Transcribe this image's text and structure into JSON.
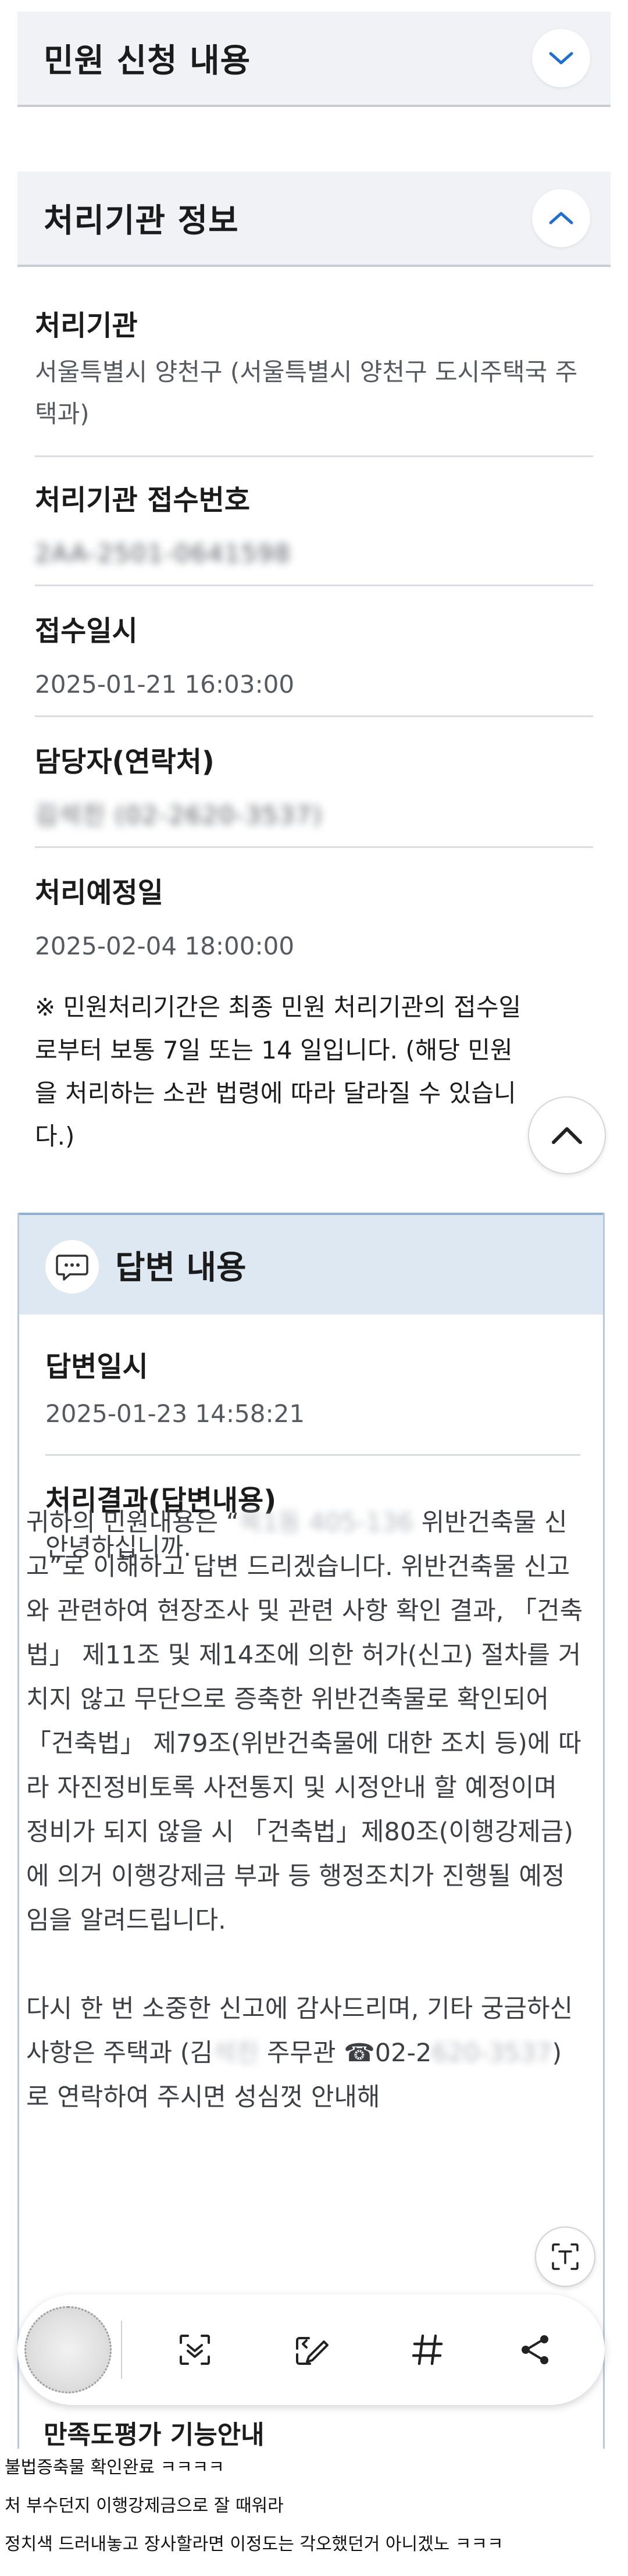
{
  "sections": {
    "complaint_title": "민원 신청 내용",
    "agency_title": "처리기관 정보"
  },
  "agency": {
    "agency_label": "처리기관",
    "agency_value": "서울특별시 양천구 (서울특별시 양천구 도시주택국 주택과)",
    "receipt_no_label": "처리기관 접수번호",
    "receipt_no_value": "2AA-2501-0641598",
    "received_label": "접수일시",
    "received_value": "2025-01-21 16:03:00",
    "manager_label": "담당자(연락처)",
    "manager_value": "김석진 (02-2620-3537)",
    "due_label": "처리예정일",
    "due_value": "2025-02-04 18:00:00",
    "notice": "※ 민원처리기간은 최종 민원 처리기관의 접수일로부터 보통 7일 또는 14 일입니다. (해당 민원을 처리하는 소관 법령에 따라 달라질 수 있습니다.)"
  },
  "answer": {
    "title": "답변 내용",
    "date_label": "답변일시",
    "date_value": "2025-01-23 14:58:21",
    "result_label": "처리결과(답변내용)",
    "greeting": "안녕하십니까.",
    "para1_a": "귀하의 민원내용은 “",
    "para1_blur": "목1동 405-136",
    "para1_b": " 위반건축물 신고”로 이해하고 답변 드리겠습니다. 위반건축물 신고와 관련하여 현장조사 및 관련 사항 확인 결과, 「건축법」 제11조 및 제14조에 의한 허가(신고) 절차를 거치지 않고 무단으로 증축한 위반건축물로 확인되어 「건축법」 제79조(위반건축물에 대한 조치 등)에 따라 자진정비토록 사전통지 및 시정안내 할 예정이며 정비가 되지 않을 시 「건축법」제80조(이행강제금)에 의거 이행강제금 부과 등 행정조치가 진행될 예정임을 알려드립니다.",
    "para2_a": "다시 한 번 소중한 신고에 감사드리며, 기타 궁금하신 사항은 주택과 (김",
    "para2_blur": "석진",
    "para2_b": " 주무관 ☎02-2",
    "para2_blur2": "620-3537",
    "para2_c": ")로 연락하여 주시면 성심껏 안내해",
    "peek_text": "만족도평가 기능안내"
  },
  "toolbar": {
    "icons": [
      "avatar-thumbnail",
      "scan-icon",
      "edit-icon",
      "hashtag-icon",
      "share-icon"
    ]
  },
  "comments": [
    "불법증축물 확인완료 ㅋㅋㅋㅋ",
    "처 부수던지 이행강제금으로 잘 때워라",
    "정치색 드러내놓고 장사할라면 이정도는 각오했던거 아니겠노 ㅋㅋㅋ"
  ],
  "colors": {
    "accent": "#1f6fd1",
    "section_bg": "#f1f2f5",
    "answer_head_bg": "#dde8f3"
  }
}
